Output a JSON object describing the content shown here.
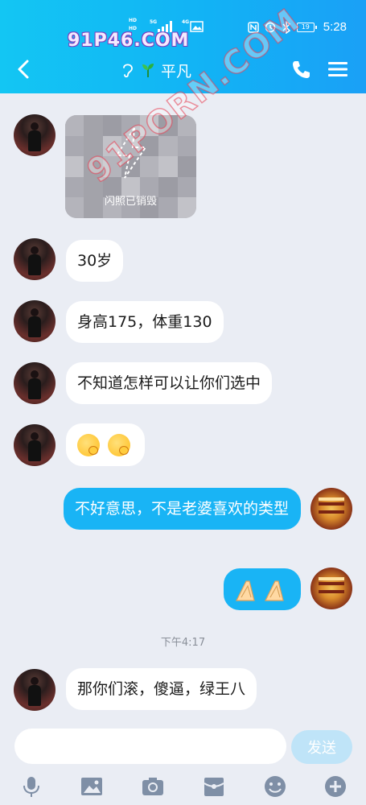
{
  "status_bar": {
    "time": "5:28",
    "battery": "19",
    "network": [
      "HD",
      "5G",
      "4G"
    ]
  },
  "watermarks": {
    "top": "91P46.COM",
    "diagonal": "91PORN.COM"
  },
  "header": {
    "title": "平凡",
    "colors": {
      "from": "#13c6f3",
      "to": "#1aa0f6"
    }
  },
  "flash_photo": {
    "label": "闪照已销毁"
  },
  "messages": [
    {
      "side": "left",
      "text": "30岁"
    },
    {
      "side": "left",
      "text": "身高175，体重130"
    },
    {
      "side": "left",
      "text": "不知道怎样可以让你们选中"
    },
    {
      "side": "left",
      "emoji": [
        "smirk-face",
        "smirk-face"
      ]
    },
    {
      "side": "right",
      "text": "不好意思，不是老婆喜欢的类型"
    },
    {
      "side": "right",
      "emoji": [
        "folded-hands",
        "folded-hands"
      ]
    }
  ],
  "timestamp": "下午4:17",
  "last_message": {
    "side": "left",
    "text": "那你们滚，傻逼，绿王八"
  },
  "composer": {
    "placeholder": "",
    "send_label": "发送",
    "tools": [
      "microphone-icon",
      "image-icon",
      "camera-icon",
      "red-packet-icon",
      "emoji-icon",
      "plus-icon"
    ]
  }
}
